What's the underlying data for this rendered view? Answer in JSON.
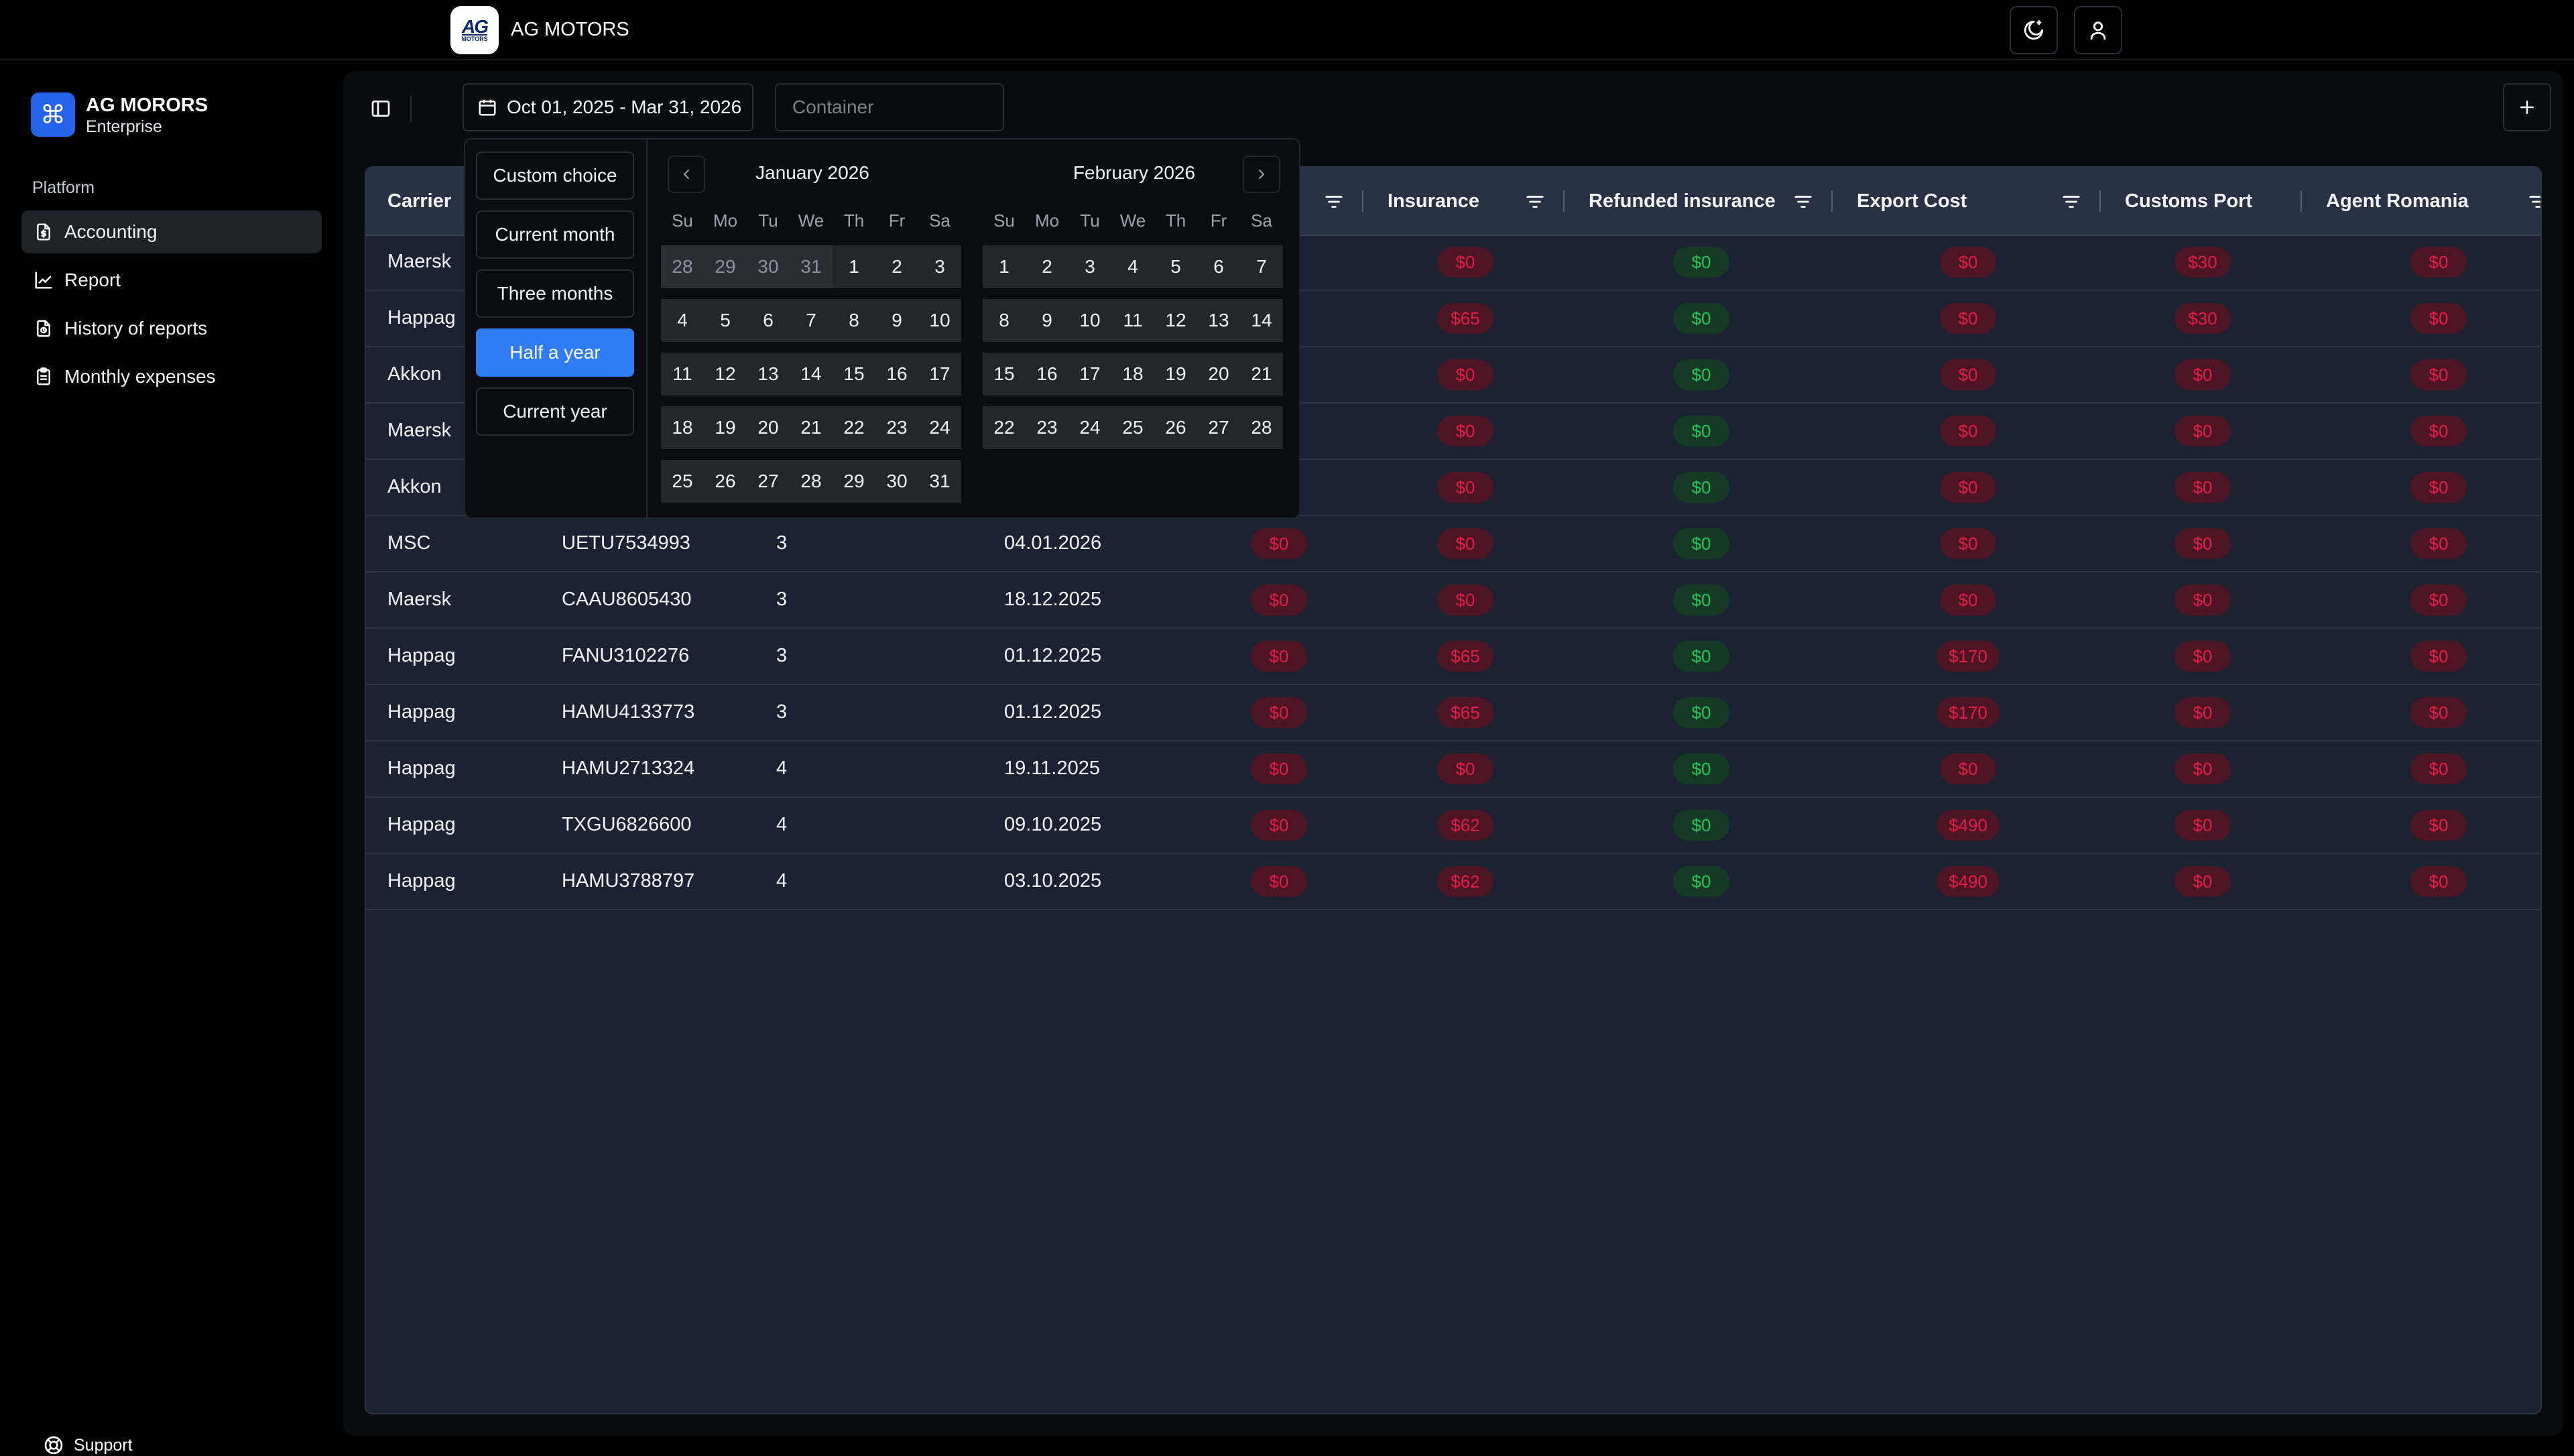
{
  "header": {
    "brand": "AG MOTORS",
    "logo_text": "AG",
    "logo_sub": "MOTORS"
  },
  "sidebar": {
    "workspace_name": "AG MORORS",
    "workspace_plan": "Enterprise",
    "section_label": "Platform",
    "items": [
      {
        "label": "Accounting",
        "active": true,
        "icon": "file-dollar-icon"
      },
      {
        "label": "Report",
        "active": false,
        "icon": "chart-line-icon"
      },
      {
        "label": "History of reports",
        "active": false,
        "icon": "history-file-icon"
      },
      {
        "label": "Monthly expenses",
        "active": false,
        "icon": "clipboard-icon"
      }
    ],
    "support_label": "Support"
  },
  "toolbar": {
    "date_range": "Oct 01, 2025 - Mar 31, 2026",
    "container_placeholder": "Container"
  },
  "datepicker": {
    "presets": [
      "Custom choice",
      "Current month",
      "Three months",
      "Half a year",
      "Current year"
    ],
    "selected_preset": "Half a year",
    "weekdays": [
      "Su",
      "Mo",
      "Tu",
      "We",
      "Th",
      "Fr",
      "Sa"
    ],
    "months": [
      {
        "title": "January 2026",
        "weeks": [
          [
            "28",
            "29",
            "30",
            "31",
            "1",
            "2",
            "3"
          ],
          [
            "4",
            "5",
            "6",
            "7",
            "8",
            "9",
            "10"
          ],
          [
            "11",
            "12",
            "13",
            "14",
            "15",
            "16",
            "17"
          ],
          [
            "18",
            "19",
            "20",
            "21",
            "22",
            "23",
            "24"
          ],
          [
            "25",
            "26",
            "27",
            "28",
            "29",
            "30",
            "31"
          ]
        ],
        "outside_days_leading": 4
      },
      {
        "title": "February 2026",
        "weeks": [
          [
            "1",
            "2",
            "3",
            "4",
            "5",
            "6",
            "7"
          ],
          [
            "8",
            "9",
            "10",
            "11",
            "12",
            "13",
            "14"
          ],
          [
            "15",
            "16",
            "17",
            "18",
            "19",
            "20",
            "21"
          ],
          [
            "22",
            "23",
            "24",
            "25",
            "26",
            "27",
            "28"
          ]
        ],
        "outside_days_leading": 0
      }
    ]
  },
  "table": {
    "columns": {
      "carrier": "Carrier",
      "insurance": "Insurance",
      "refunded_insurance": "Refunded insurance",
      "export_cost": "Export Cost",
      "customs_port": "Customs Port",
      "agent_romania": "Agent Romania"
    },
    "rows": [
      {
        "carrier": "Maersk",
        "container": "",
        "qty": "",
        "date": "",
        "col1": "",
        "insurance": "$0",
        "refunded": "$0",
        "export": "$0",
        "customs": "$30",
        "agent": "$0"
      },
      {
        "carrier": "Happag",
        "container": "",
        "qty": "",
        "date": "",
        "col1": "",
        "insurance": "$65",
        "refunded": "$0",
        "export": "$0",
        "customs": "$30",
        "agent": "$0"
      },
      {
        "carrier": "Akkon",
        "container": "",
        "qty": "",
        "date": "",
        "col1": "",
        "insurance": "$0",
        "refunded": "$0",
        "export": "$0",
        "customs": "$0",
        "agent": "$0"
      },
      {
        "carrier": "Maersk",
        "container": "",
        "qty": "",
        "date": "",
        "col1": "",
        "insurance": "$0",
        "refunded": "$0",
        "export": "$0",
        "customs": "$0",
        "agent": "$0"
      },
      {
        "carrier": "Akkon",
        "container": "",
        "qty": "",
        "date": "",
        "col1": "",
        "insurance": "$0",
        "refunded": "$0",
        "export": "$0",
        "customs": "$0",
        "agent": "$0"
      },
      {
        "carrier": "MSC",
        "container": "UETU7534993",
        "qty": "3",
        "date": "04.01.2026",
        "col1": "$0",
        "insurance": "$0",
        "refunded": "$0",
        "export": "$0",
        "customs": "$0",
        "agent": "$0"
      },
      {
        "carrier": "Maersk",
        "container": "CAAU8605430",
        "qty": "3",
        "date": "18.12.2025",
        "col1": "$0",
        "insurance": "$0",
        "refunded": "$0",
        "export": "$0",
        "customs": "$0",
        "agent": "$0"
      },
      {
        "carrier": "Happag",
        "container": "FANU3102276",
        "qty": "3",
        "date": "01.12.2025",
        "col1": "$0",
        "insurance": "$65",
        "refunded": "$0",
        "export": "$170",
        "customs": "$0",
        "agent": "$0"
      },
      {
        "carrier": "Happag",
        "container": "HAMU4133773",
        "qty": "3",
        "date": "01.12.2025",
        "col1": "$0",
        "insurance": "$65",
        "refunded": "$0",
        "export": "$170",
        "customs": "$0",
        "agent": "$0"
      },
      {
        "carrier": "Happag",
        "container": "HAMU2713324",
        "qty": "4",
        "date": "19.11.2025",
        "col1": "$0",
        "insurance": "$0",
        "refunded": "$0",
        "export": "$0",
        "customs": "$0",
        "agent": "$0"
      },
      {
        "carrier": "Happag",
        "container": "TXGU6826600",
        "qty": "4",
        "date": "09.10.2025",
        "col1": "$0",
        "insurance": "$62",
        "refunded": "$0",
        "export": "$490",
        "customs": "$0",
        "agent": "$0"
      },
      {
        "carrier": "Happag",
        "container": "HAMU3788797",
        "qty": "4",
        "date": "03.10.2025",
        "col1": "$0",
        "insurance": "$62",
        "refunded": "$0",
        "export": "$490",
        "customs": "$0",
        "agent": "$0"
      }
    ]
  },
  "colors": {
    "accent": "#2f7cf6",
    "negative": "#e11d48",
    "positive": "#22c55e",
    "table_bg": "#1b2332"
  }
}
